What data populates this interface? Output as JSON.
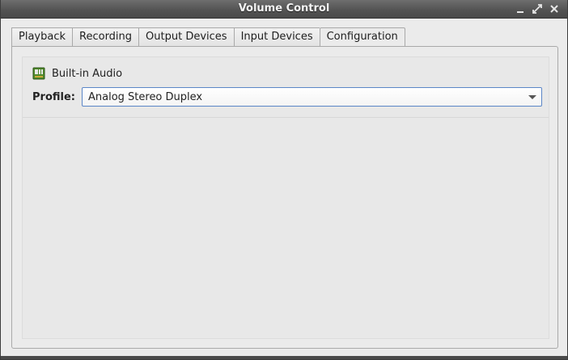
{
  "window": {
    "title": "Volume Control",
    "controls": [
      "minimize-icon",
      "maximize-icon",
      "close-icon"
    ]
  },
  "tabs": [
    {
      "label": "Playback",
      "active": false
    },
    {
      "label": "Recording",
      "active": false
    },
    {
      "label": "Output Devices",
      "active": false
    },
    {
      "label": "Input Devices",
      "active": false
    },
    {
      "label": "Configuration",
      "active": true
    }
  ],
  "configuration": {
    "device": {
      "icon": "sound-card-icon",
      "name": "Built-in Audio"
    },
    "profile": {
      "label": "Profile:",
      "value": "Analog Stereo Duplex"
    }
  },
  "colors": {
    "titlebar": "#545454",
    "background": "#ebebeb",
    "focus_border": "#5b86c7",
    "icon_green": "#4f8a2b"
  }
}
